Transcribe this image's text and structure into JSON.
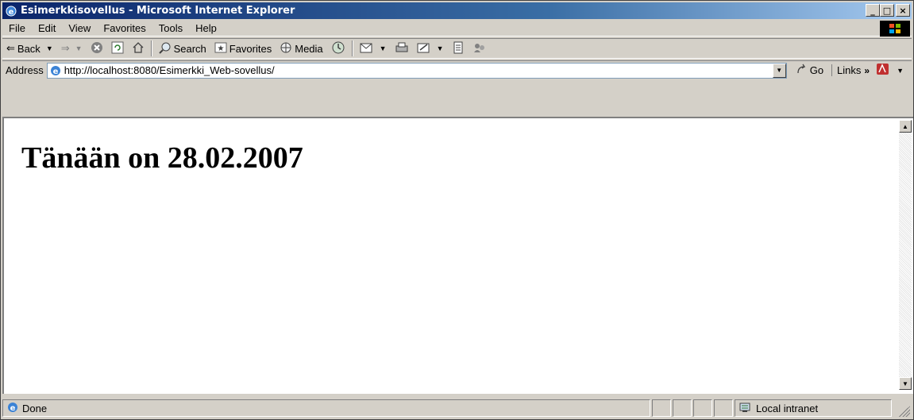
{
  "window": {
    "title": "Esimerkkisovellus - Microsoft Internet Explorer",
    "minimize": "_",
    "maximize": "□",
    "close": "×"
  },
  "menu": [
    "File",
    "Edit",
    "View",
    "Favorites",
    "Tools",
    "Help"
  ],
  "toolbar": {
    "back": "Back",
    "search": "Search",
    "favorites": "Favorites",
    "media": "Media"
  },
  "address": {
    "label": "Address",
    "url": "http://localhost:8080/Esimerkki_Web-sovellus/",
    "go": "Go",
    "links": "Links"
  },
  "page": {
    "heading": "Tänään on 28.02.2007"
  },
  "status": {
    "text": "Done",
    "zone": "Local intranet"
  },
  "colors": {
    "titlebar_start": "#0a246a",
    "titlebar_end": "#a6caf0",
    "chrome": "#d4d0c8"
  }
}
